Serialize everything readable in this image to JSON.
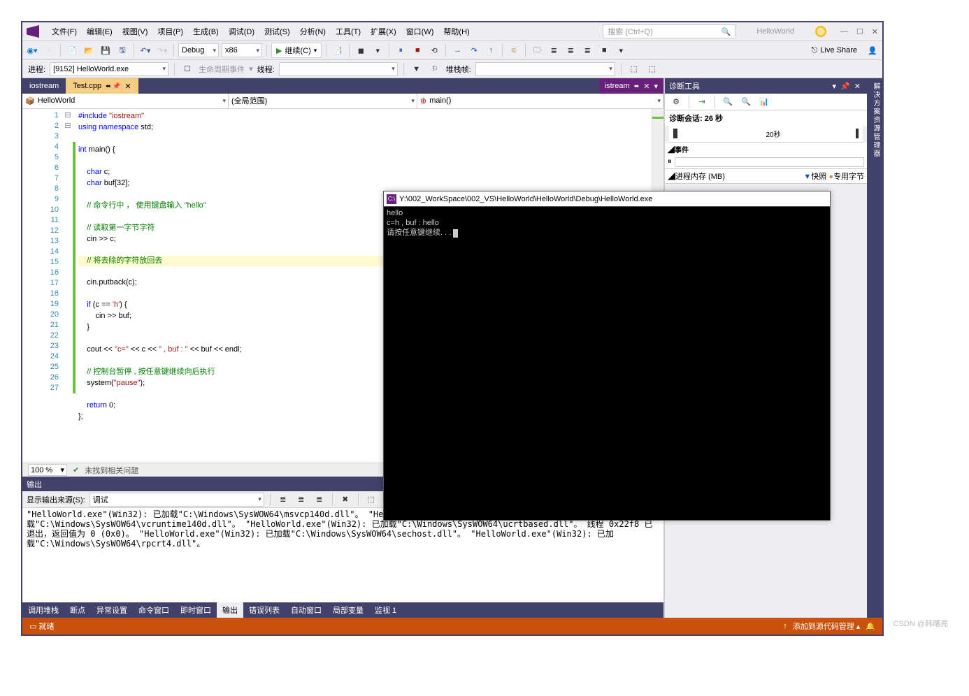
{
  "window": {
    "solution": "HelloWorld"
  },
  "search": {
    "placeholder": "搜索 (Ctrl+Q)"
  },
  "menu": [
    "文件(F)",
    "编辑(E)",
    "视图(V)",
    "项目(P)",
    "生成(B)",
    "调试(D)",
    "测试(S)",
    "分析(N)",
    "工具(T)",
    "扩展(X)",
    "窗口(W)",
    "帮助(H)"
  ],
  "toolbar": {
    "config": "Debug",
    "platform": "x86",
    "continue": "继续(C)",
    "live_share": "Live Share"
  },
  "toolbar2": {
    "process_label": "进程:",
    "process": "[9152] HelloWorld.exe",
    "lifecycle": "生命周期事件",
    "thread_label": "线程:",
    "stack_label": "堆栈帧:"
  },
  "tabs": {
    "inactive": "iostream",
    "active": "Test.cpp",
    "right": "istream"
  },
  "nav": {
    "scope": "HelloWorld",
    "scope2": "(全局范围)",
    "func": "main()"
  },
  "code": {
    "lines": [
      {
        "n": 1,
        "html": "<span class='kw'>#include</span> <span class='str'>\"iostream\"</span>"
      },
      {
        "n": 2,
        "html": "<span class='kw'>using</span> <span class='kw'>namespace</span> std;"
      },
      {
        "n": 3,
        "html": ""
      },
      {
        "n": 4,
        "fold": "⊟",
        "html": "<span class='kw'>int</span> main() {",
        "g": true
      },
      {
        "n": 5,
        "html": "",
        "g": true
      },
      {
        "n": 6,
        "html": "    <span class='kw'>char</span> c;",
        "g": true
      },
      {
        "n": 7,
        "html": "    <span class='kw'>char</span> buf[32];",
        "g": true
      },
      {
        "n": 8,
        "html": "",
        "g": true
      },
      {
        "n": 9,
        "html": "    <span class='cmt'>// 命令行中 ， 使用键盘输入 \"hello\"</span>",
        "g": true
      },
      {
        "n": 10,
        "html": "",
        "g": true
      },
      {
        "n": 11,
        "html": "    <span class='cmt'>// 读取第一字节字符</span>",
        "g": true
      },
      {
        "n": 12,
        "html": "    cin >> c;",
        "g": true
      },
      {
        "n": 13,
        "html": "",
        "g": true
      },
      {
        "n": 14,
        "html": "    <span class='cmt'>// 将去除的字符放回去</span>",
        "g": true,
        "hl": true
      },
      {
        "n": 15,
        "html": "    cin.putback(c);",
        "g": true
      },
      {
        "n": 16,
        "html": "",
        "g": true
      },
      {
        "n": 17,
        "fold": "⊟",
        "html": "    <span class='kw'>if</span> (c == <span class='str'>'h'</span>) {",
        "g": true
      },
      {
        "n": 18,
        "html": "        cin >> buf;",
        "g": true
      },
      {
        "n": 19,
        "html": "    }",
        "g": true
      },
      {
        "n": 20,
        "html": "",
        "g": true
      },
      {
        "n": 21,
        "html": "    cout &lt;&lt; <span class='str'>\"c=\"</span> &lt;&lt; c &lt;&lt; <span class='str'>\" , buf : \"</span> &lt;&lt; buf &lt;&lt; endl;",
        "g": true
      },
      {
        "n": 22,
        "html": "",
        "g": true
      },
      {
        "n": 23,
        "html": "    <span class='cmt'>// 控制台暂停 , 按任意键继续向后执行</span>",
        "g": true
      },
      {
        "n": 24,
        "html": "    system(<span class='str'>\"pause\"</span>);",
        "g": true
      },
      {
        "n": 25,
        "html": "",
        "g": true
      },
      {
        "n": 26,
        "html": "    <span class='kw'>return</span> 0;",
        "g": true
      },
      {
        "n": 27,
        "html": "};",
        "g": true
      }
    ],
    "zoom": "100 %",
    "no_issues": "未找到相关问题"
  },
  "output": {
    "title": "输出",
    "source_label": "显示输出来源(S):",
    "source": "调试",
    "lines": [
      "\"HelloWorld.exe\"(Win32): 已加载\"C:\\Windows\\SysWOW64\\msvcp140d.dll\"。",
      "\"HelloWorld.exe\"(Win32): 已加载\"C:\\Windows\\SysWOW64\\vcruntime140d.dll\"。",
      "\"HelloWorld.exe\"(Win32): 已加载\"C:\\Windows\\SysWOW64\\ucrtbased.dll\"。",
      "线程 0x22f8 已退出，返回值为 0 (0x0)。",
      "\"HelloWorld.exe\"(Win32): 已加载\"C:\\Windows\\SysWOW64\\sechost.dll\"。",
      "\"HelloWorld.exe\"(Win32): 已加载\"C:\\Windows\\SysWOW64\\rpcrt4.dll\"。"
    ]
  },
  "bottom_tabs": [
    "调用堆栈",
    "断点",
    "异常设置",
    "命令窗口",
    "即时窗口",
    "输出",
    "错误列表",
    "自动窗口",
    "局部变量",
    "监视 1"
  ],
  "bottom_active": 5,
  "diag": {
    "title": "诊断工具",
    "session": "诊断会话: 26 秒",
    "time_label": "20秒",
    "events": "◢事件",
    "mem": "◢进程内存 (MB)",
    "snapshot": "快照",
    "private": "专用字节"
  },
  "right_dock": "解决方案资源管理器",
  "status": {
    "ready": "就绪",
    "scm": "添加到源代码管理"
  },
  "console": {
    "title": "Y:\\002_WorkSpace\\002_VS\\HelloWorld\\HelloWorld\\Debug\\HelloWorld.exe",
    "lines": [
      "hello",
      "c=h , buf : hello",
      "请按任意键继续. . . "
    ]
  },
  "watermark": "CSDN @韩曙亮"
}
